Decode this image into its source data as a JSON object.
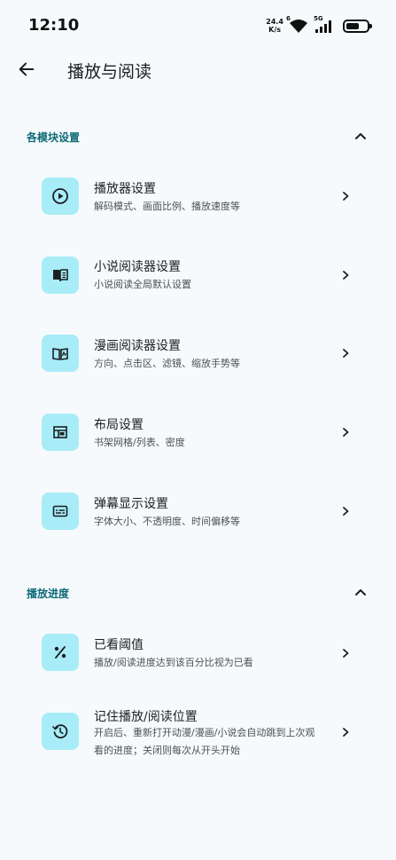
{
  "status": {
    "time": "12:10",
    "net_speed_value": "24.4",
    "net_speed_unit": "K/s",
    "wifi_badge": "6",
    "cell_badge": "5G",
    "battery_level": 0.65
  },
  "app_bar": {
    "title": "播放与阅读",
    "back_icon": "arrow-left-icon"
  },
  "sections": [
    {
      "title": "各模块设置",
      "collapse_icon": "chevron-up-icon",
      "items": [
        {
          "icon": "play-circle-icon",
          "title": "播放器设置",
          "subtitle": "解码模式、画面比例、播放速度等"
        },
        {
          "icon": "book-icon",
          "title": "小说阅读器设置",
          "subtitle": "小说阅读全局默认设置"
        },
        {
          "icon": "manga-book-icon",
          "title": "漫画阅读器设置",
          "subtitle": "方向、点击区、滤镜、缩放手势等"
        },
        {
          "icon": "layout-icon",
          "title": "布局设置",
          "subtitle": "书架网格/列表、密度"
        },
        {
          "icon": "subtitles-icon",
          "title": "弹幕显示设置",
          "subtitle": "字体大小、不透明度、时间偏移等"
        }
      ]
    },
    {
      "title": "播放进度",
      "collapse_icon": "chevron-up-icon",
      "items": [
        {
          "icon": "percent-icon",
          "title": "已看阈值",
          "subtitle": "播放/阅读进度达到该百分比视为已看"
        },
        {
          "icon": "history-icon",
          "title": "记住播放/阅读位置",
          "subtitle": "开启后、重新打开动漫/漫画/小说会自动跳到上次观看的进度；关闭则每次从开头开始"
        }
      ]
    }
  ],
  "colors": {
    "background": "#f6fafc",
    "accent": "#0e6a78",
    "icon_tile": "#a8ecf8"
  }
}
